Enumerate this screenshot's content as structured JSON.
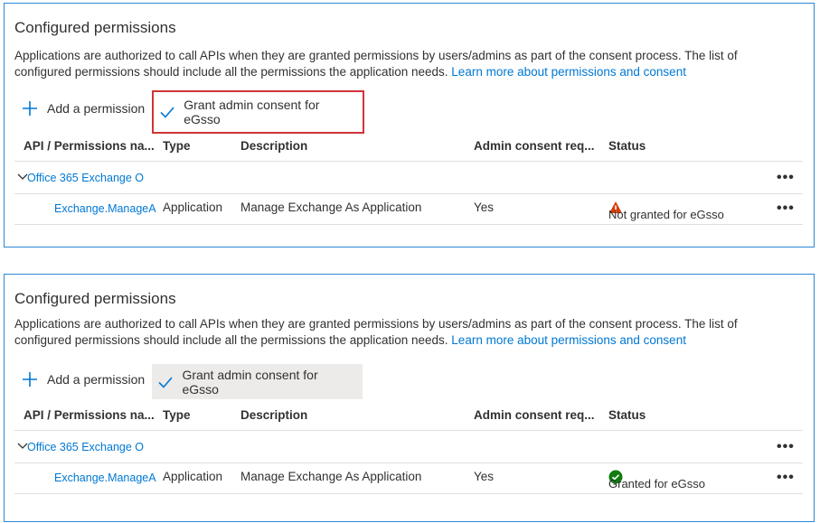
{
  "panels": [
    {
      "title": "Configured permissions",
      "description": "Applications are authorized to call APIs when they are granted permissions by users/admins as part of the consent process. The list of configured permissions should include all the permissions the application needs.",
      "learn_more": "Learn more about permissions and consent",
      "toolbar": {
        "add_label": "Add a permission",
        "grant_label": "Grant admin consent for eGsso"
      },
      "columns": [
        "API / Permissions na...",
        "Type",
        "Description",
        "Admin consent req...",
        "Status"
      ],
      "group_name": "Office 365 Exchange O",
      "row": {
        "permission": "Exchange.ManageA",
        "type": "Application",
        "description": "Manage Exchange As Application",
        "admin_consent": "Yes",
        "status": "Not granted for eGsso"
      },
      "more_label": "•••"
    },
    {
      "title": "Configured permissions",
      "description": "Applications are authorized to call APIs when they are granted permissions by users/admins as part of the consent process. The list of configured permissions should include all the permissions the application needs.",
      "learn_more": "Learn more about permissions and consent",
      "toolbar": {
        "add_label": "Add a permission",
        "grant_label": "Grant admin consent for eGsso"
      },
      "columns": [
        "API / Permissions na...",
        "Type",
        "Description",
        "Admin consent req...",
        "Status"
      ],
      "group_name": "Office 365 Exchange O",
      "row": {
        "permission": "Exchange.ManageA",
        "type": "Application",
        "description": "Manage Exchange As Application",
        "admin_consent": "Yes",
        "status": "Granted for eGsso"
      },
      "more_label": "•••"
    }
  ],
  "colors": {
    "accent": "#0078d4",
    "warning": "#d83b01",
    "success": "#107c10",
    "highlight_border": "#d13438"
  },
  "icons": {
    "add": "plus-icon",
    "grant": "checkmark-icon",
    "expand": "chevron-down-icon",
    "warning": "warning-icon",
    "granted": "check-circle-icon",
    "more": "more-icon"
  }
}
